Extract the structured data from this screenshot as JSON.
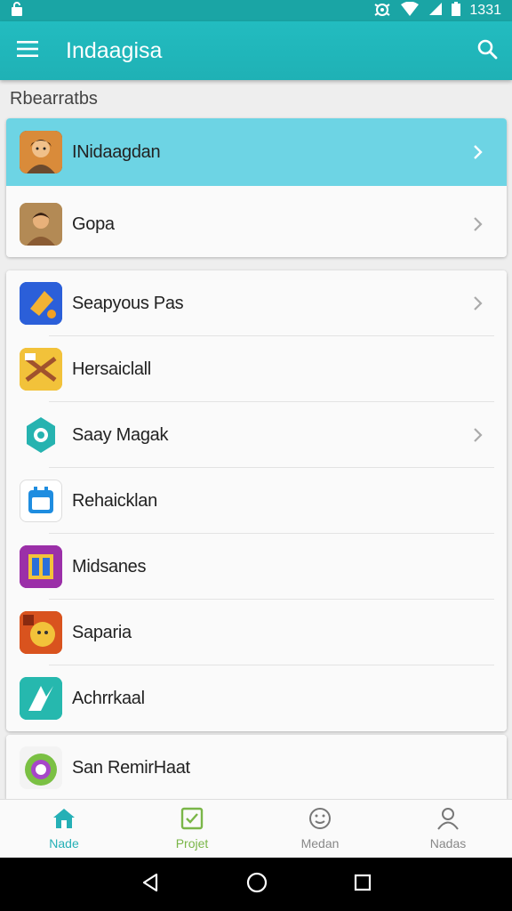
{
  "status_bar": {
    "time": "1331"
  },
  "app_bar": {
    "title": "Indaagisa"
  },
  "section": {
    "label": "Rbearratbs"
  },
  "top_card": [
    {
      "label": "INidaagdan",
      "icon": "person-avatar-icon",
      "highlight": true
    },
    {
      "label": "Gopa",
      "icon": "person-avatar-icon"
    }
  ],
  "main_card": [
    {
      "label": "Seapyous Pas",
      "icon": "tool-icon"
    },
    {
      "label": "Hersaiclall",
      "icon": "cart-icon"
    },
    {
      "label": "Saay Magak",
      "icon": "settings-icon"
    },
    {
      "label": "Rehaicklan",
      "icon": "calendar-icon"
    },
    {
      "label": "Midsanes",
      "icon": "book-icon"
    },
    {
      "label": "Saparia",
      "icon": "game-icon"
    },
    {
      "label": "Achrrkaal",
      "icon": "brand-icon"
    }
  ],
  "partial_card": {
    "label": "San RemirHaat",
    "icon": "camera-icon"
  },
  "bottom_nav": [
    {
      "label": "Nade",
      "icon": "home-icon"
    },
    {
      "label": "Projet",
      "icon": "check-box-icon"
    },
    {
      "label": "Medan",
      "icon": "smiley-icon"
    },
    {
      "label": "Nadas",
      "icon": "profile-icon"
    }
  ],
  "colors": {
    "accent": "#1fb1b5",
    "highlight": "#6dd4e4",
    "status": "#1aa5a5"
  }
}
